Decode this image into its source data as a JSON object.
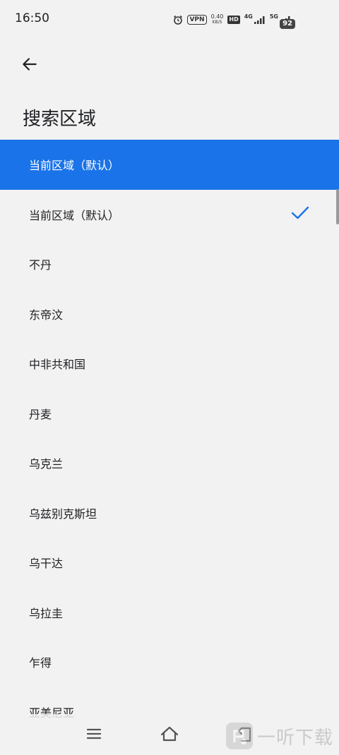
{
  "status_bar": {
    "time": "16:50",
    "vpn": "VPN",
    "speed_value": "0.40",
    "speed_unit": "KB/S",
    "hd": "HD",
    "network_1": "4G",
    "network_2": "5G",
    "battery": "92"
  },
  "header": {
    "back_icon": "arrow-left-icon",
    "title": "搜索区域"
  },
  "regions": [
    "当前区域（默认）",
    "当前区域（默认）",
    "不丹",
    "东帝汶",
    "中非共和国",
    "丹麦",
    "乌克兰",
    "乌兹别克斯坦",
    "乌干达",
    "乌拉圭",
    "乍得",
    "亚美尼亚"
  ],
  "selected_index": 1,
  "highlighted_index": 0,
  "colors": {
    "accent": "#1a73e8",
    "background": "#f2f2f2",
    "text": "#202124"
  },
  "nav_bar": {
    "menu_icon": "menu-icon",
    "home_icon": "home-icon",
    "back_icon": "back-icon"
  },
  "watermark": {
    "text": "一听下载"
  }
}
